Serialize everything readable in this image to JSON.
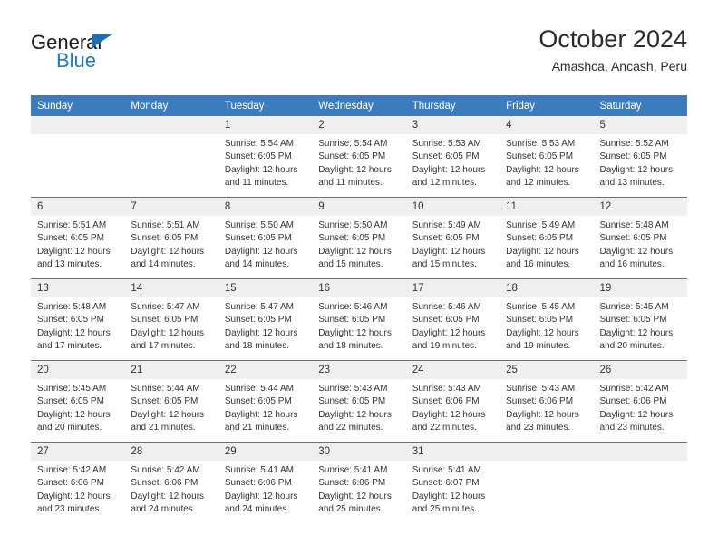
{
  "brand": {
    "name_top": "General",
    "name_bottom": "Blue",
    "accent_color": "#2079c4",
    "triangle_icon": "triangle-icon"
  },
  "header": {
    "title": "October 2024",
    "subtitle": "Amashca, Ancash, Peru"
  },
  "calendar": {
    "header_bg": "#3a7cbe",
    "daynum_bg": "#efefef",
    "weekday_headers": [
      "Sunday",
      "Monday",
      "Tuesday",
      "Wednesday",
      "Thursday",
      "Friday",
      "Saturday"
    ],
    "weeks": [
      [
        {
          "day": "",
          "sunrise": "",
          "sunset": "",
          "daylight_line1": "",
          "daylight_line2": ""
        },
        {
          "day": "",
          "sunrise": "",
          "sunset": "",
          "daylight_line1": "",
          "daylight_line2": ""
        },
        {
          "day": "1",
          "sunrise": "Sunrise: 5:54 AM",
          "sunset": "Sunset: 6:05 PM",
          "daylight_line1": "Daylight: 12 hours",
          "daylight_line2": "and 11 minutes."
        },
        {
          "day": "2",
          "sunrise": "Sunrise: 5:54 AM",
          "sunset": "Sunset: 6:05 PM",
          "daylight_line1": "Daylight: 12 hours",
          "daylight_line2": "and 11 minutes."
        },
        {
          "day": "3",
          "sunrise": "Sunrise: 5:53 AM",
          "sunset": "Sunset: 6:05 PM",
          "daylight_line1": "Daylight: 12 hours",
          "daylight_line2": "and 12 minutes."
        },
        {
          "day": "4",
          "sunrise": "Sunrise: 5:53 AM",
          "sunset": "Sunset: 6:05 PM",
          "daylight_line1": "Daylight: 12 hours",
          "daylight_line2": "and 12 minutes."
        },
        {
          "day": "5",
          "sunrise": "Sunrise: 5:52 AM",
          "sunset": "Sunset: 6:05 PM",
          "daylight_line1": "Daylight: 12 hours",
          "daylight_line2": "and 13 minutes."
        }
      ],
      [
        {
          "day": "6",
          "sunrise": "Sunrise: 5:51 AM",
          "sunset": "Sunset: 6:05 PM",
          "daylight_line1": "Daylight: 12 hours",
          "daylight_line2": "and 13 minutes."
        },
        {
          "day": "7",
          "sunrise": "Sunrise: 5:51 AM",
          "sunset": "Sunset: 6:05 PM",
          "daylight_line1": "Daylight: 12 hours",
          "daylight_line2": "and 14 minutes."
        },
        {
          "day": "8",
          "sunrise": "Sunrise: 5:50 AM",
          "sunset": "Sunset: 6:05 PM",
          "daylight_line1": "Daylight: 12 hours",
          "daylight_line2": "and 14 minutes."
        },
        {
          "day": "9",
          "sunrise": "Sunrise: 5:50 AM",
          "sunset": "Sunset: 6:05 PM",
          "daylight_line1": "Daylight: 12 hours",
          "daylight_line2": "and 15 minutes."
        },
        {
          "day": "10",
          "sunrise": "Sunrise: 5:49 AM",
          "sunset": "Sunset: 6:05 PM",
          "daylight_line1": "Daylight: 12 hours",
          "daylight_line2": "and 15 minutes."
        },
        {
          "day": "11",
          "sunrise": "Sunrise: 5:49 AM",
          "sunset": "Sunset: 6:05 PM",
          "daylight_line1": "Daylight: 12 hours",
          "daylight_line2": "and 16 minutes."
        },
        {
          "day": "12",
          "sunrise": "Sunrise: 5:48 AM",
          "sunset": "Sunset: 6:05 PM",
          "daylight_line1": "Daylight: 12 hours",
          "daylight_line2": "and 16 minutes."
        }
      ],
      [
        {
          "day": "13",
          "sunrise": "Sunrise: 5:48 AM",
          "sunset": "Sunset: 6:05 PM",
          "daylight_line1": "Daylight: 12 hours",
          "daylight_line2": "and 17 minutes."
        },
        {
          "day": "14",
          "sunrise": "Sunrise: 5:47 AM",
          "sunset": "Sunset: 6:05 PM",
          "daylight_line1": "Daylight: 12 hours",
          "daylight_line2": "and 17 minutes."
        },
        {
          "day": "15",
          "sunrise": "Sunrise: 5:47 AM",
          "sunset": "Sunset: 6:05 PM",
          "daylight_line1": "Daylight: 12 hours",
          "daylight_line2": "and 18 minutes."
        },
        {
          "day": "16",
          "sunrise": "Sunrise: 5:46 AM",
          "sunset": "Sunset: 6:05 PM",
          "daylight_line1": "Daylight: 12 hours",
          "daylight_line2": "and 18 minutes."
        },
        {
          "day": "17",
          "sunrise": "Sunrise: 5:46 AM",
          "sunset": "Sunset: 6:05 PM",
          "daylight_line1": "Daylight: 12 hours",
          "daylight_line2": "and 19 minutes."
        },
        {
          "day": "18",
          "sunrise": "Sunrise: 5:45 AM",
          "sunset": "Sunset: 6:05 PM",
          "daylight_line1": "Daylight: 12 hours",
          "daylight_line2": "and 19 minutes."
        },
        {
          "day": "19",
          "sunrise": "Sunrise: 5:45 AM",
          "sunset": "Sunset: 6:05 PM",
          "daylight_line1": "Daylight: 12 hours",
          "daylight_line2": "and 20 minutes."
        }
      ],
      [
        {
          "day": "20",
          "sunrise": "Sunrise: 5:45 AM",
          "sunset": "Sunset: 6:05 PM",
          "daylight_line1": "Daylight: 12 hours",
          "daylight_line2": "and 20 minutes."
        },
        {
          "day": "21",
          "sunrise": "Sunrise: 5:44 AM",
          "sunset": "Sunset: 6:05 PM",
          "daylight_line1": "Daylight: 12 hours",
          "daylight_line2": "and 21 minutes."
        },
        {
          "day": "22",
          "sunrise": "Sunrise: 5:44 AM",
          "sunset": "Sunset: 6:05 PM",
          "daylight_line1": "Daylight: 12 hours",
          "daylight_line2": "and 21 minutes."
        },
        {
          "day": "23",
          "sunrise": "Sunrise: 5:43 AM",
          "sunset": "Sunset: 6:05 PM",
          "daylight_line1": "Daylight: 12 hours",
          "daylight_line2": "and 22 minutes."
        },
        {
          "day": "24",
          "sunrise": "Sunrise: 5:43 AM",
          "sunset": "Sunset: 6:06 PM",
          "daylight_line1": "Daylight: 12 hours",
          "daylight_line2": "and 22 minutes."
        },
        {
          "day": "25",
          "sunrise": "Sunrise: 5:43 AM",
          "sunset": "Sunset: 6:06 PM",
          "daylight_line1": "Daylight: 12 hours",
          "daylight_line2": "and 23 minutes."
        },
        {
          "day": "26",
          "sunrise": "Sunrise: 5:42 AM",
          "sunset": "Sunset: 6:06 PM",
          "daylight_line1": "Daylight: 12 hours",
          "daylight_line2": "and 23 minutes."
        }
      ],
      [
        {
          "day": "27",
          "sunrise": "Sunrise: 5:42 AM",
          "sunset": "Sunset: 6:06 PM",
          "daylight_line1": "Daylight: 12 hours",
          "daylight_line2": "and 23 minutes."
        },
        {
          "day": "28",
          "sunrise": "Sunrise: 5:42 AM",
          "sunset": "Sunset: 6:06 PM",
          "daylight_line1": "Daylight: 12 hours",
          "daylight_line2": "and 24 minutes."
        },
        {
          "day": "29",
          "sunrise": "Sunrise: 5:41 AM",
          "sunset": "Sunset: 6:06 PM",
          "daylight_line1": "Daylight: 12 hours",
          "daylight_line2": "and 24 minutes."
        },
        {
          "day": "30",
          "sunrise": "Sunrise: 5:41 AM",
          "sunset": "Sunset: 6:06 PM",
          "daylight_line1": "Daylight: 12 hours",
          "daylight_line2": "and 25 minutes."
        },
        {
          "day": "31",
          "sunrise": "Sunrise: 5:41 AM",
          "sunset": "Sunset: 6:07 PM",
          "daylight_line1": "Daylight: 12 hours",
          "daylight_line2": "and 25 minutes."
        },
        {
          "day": "",
          "sunrise": "",
          "sunset": "",
          "daylight_line1": "",
          "daylight_line2": ""
        },
        {
          "day": "",
          "sunrise": "",
          "sunset": "",
          "daylight_line1": "",
          "daylight_line2": ""
        }
      ]
    ]
  }
}
